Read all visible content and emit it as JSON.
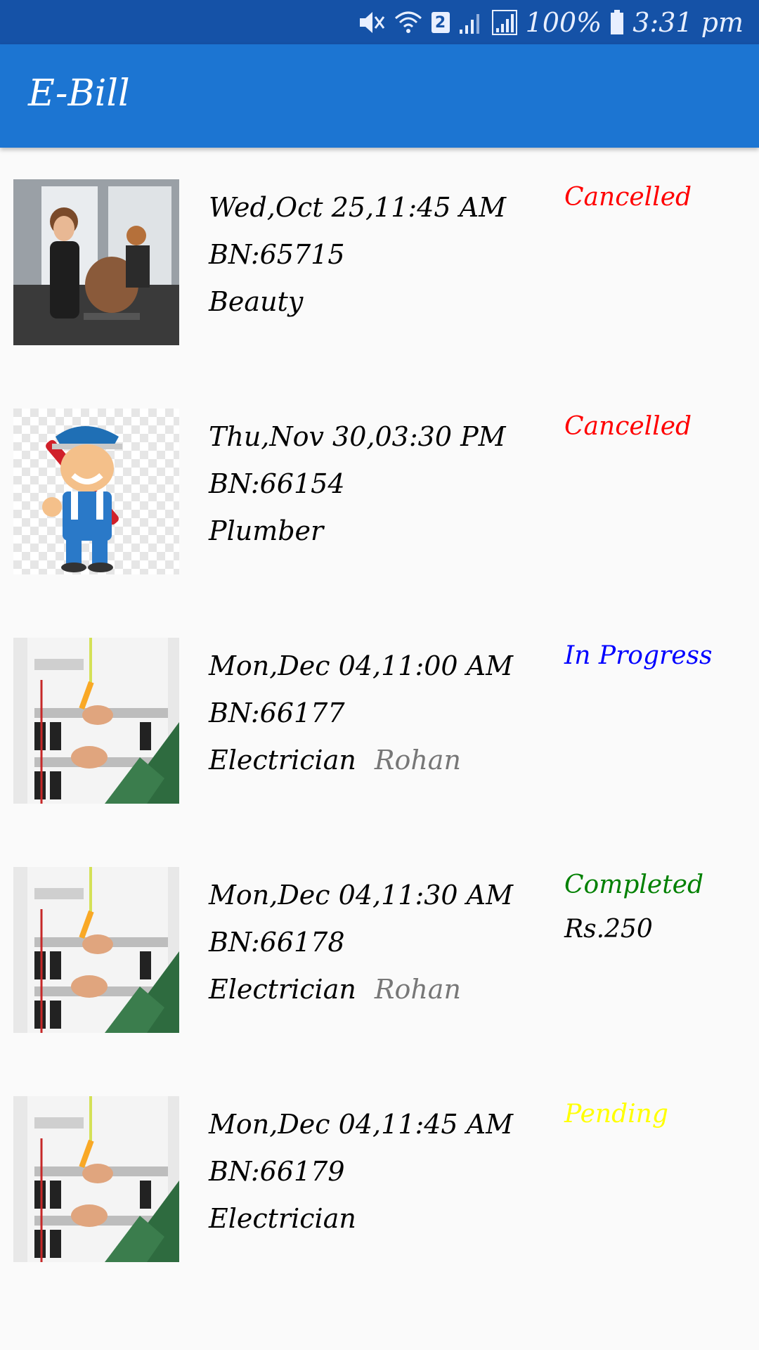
{
  "status_bar": {
    "battery": "100%",
    "time": "3:31 pm",
    "sim_slot": "2",
    "icons": [
      "mute-icon",
      "wifi-icon",
      "sim-badge",
      "signal-icon",
      "signal-icon",
      "battery-icon"
    ]
  },
  "app_bar": {
    "title": "E-Bill"
  },
  "colors": {
    "status_bar_bg": "#1552a7",
    "app_bar_bg": "#1c75d2",
    "cancelled": "#ff0000",
    "in_progress": "#0000ff",
    "completed": "#008000",
    "pending": "#ffff00",
    "worker_name": "#777777"
  },
  "bookings": [
    {
      "datetime": "Wed,Oct 25,11:45 AM",
      "bill_no": "BN:65715",
      "service": "Beauty",
      "worker": "",
      "status": "Cancelled",
      "status_color": "#ff0000",
      "amount": "",
      "thumbnail": "salon-photo"
    },
    {
      "datetime": "Thu,Nov 30,03:30 PM",
      "bill_no": "BN:66154",
      "service": "Plumber",
      "worker": "",
      "status": "Cancelled",
      "status_color": "#ff0000",
      "amount": "",
      "thumbnail": "plumber-cartoon"
    },
    {
      "datetime": "Mon,Dec 04,11:00 AM",
      "bill_no": "BN:66177",
      "service": "Electrician",
      "worker": "Rohan",
      "status": "In Progress",
      "status_color": "#0000ff",
      "amount": "",
      "thumbnail": "electrician-photo"
    },
    {
      "datetime": "Mon,Dec 04,11:30 AM",
      "bill_no": "BN:66178",
      "service": "Electrician",
      "worker": "Rohan",
      "status": "Completed",
      "status_color": "#008000",
      "amount": "Rs.250",
      "thumbnail": "electrician-photo"
    },
    {
      "datetime": "Mon,Dec 04,11:45 AM",
      "bill_no": "BN:66179",
      "service": "Electrician",
      "worker": "",
      "status": "Pending",
      "status_color": "#ffff00",
      "amount": "",
      "thumbnail": "electrician-photo"
    }
  ]
}
